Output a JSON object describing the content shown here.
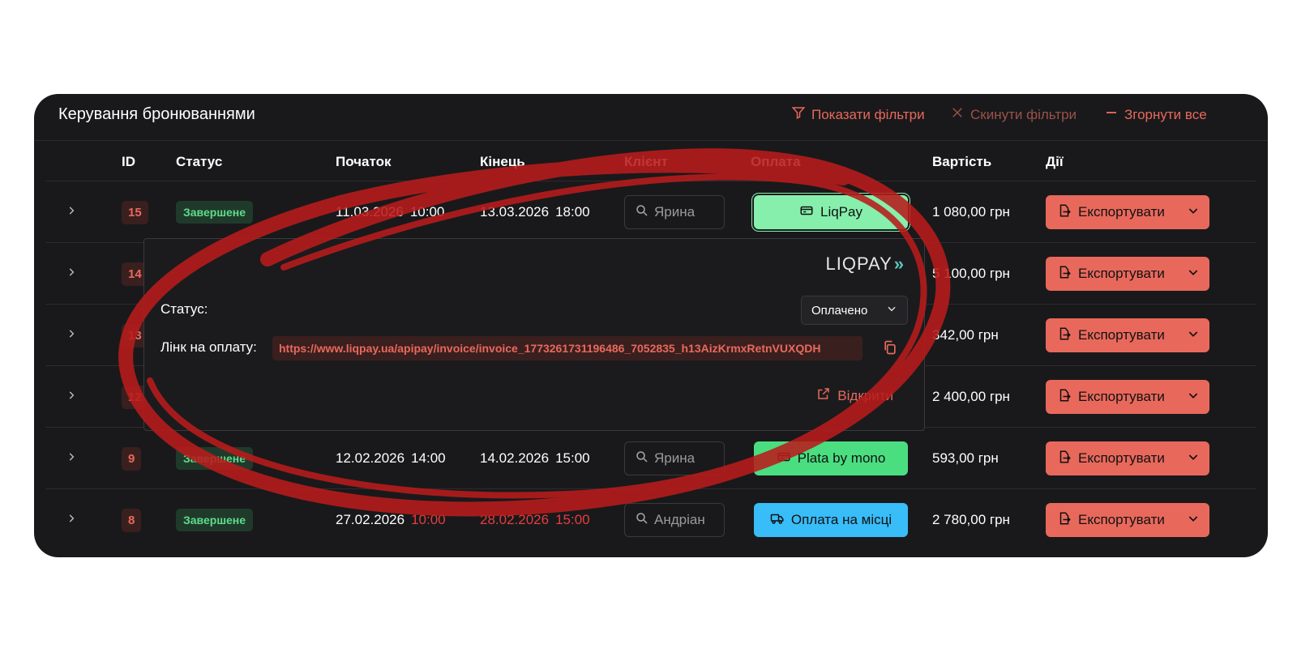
{
  "header": {
    "title": "Керування бронюваннями",
    "show_filters": "Показати фільтри",
    "reset_filters": "Скинути фільтри",
    "collapse_all": "Згорнути все"
  },
  "columns": {
    "id": "ID",
    "status": "Статус",
    "start": "Початок",
    "end": "Кінець",
    "client": "Клієнт",
    "payment": "Оплата",
    "cost": "Вартість",
    "actions": "Дії"
  },
  "rows": [
    {
      "id": "15",
      "status": "Завершене",
      "start_date": "11.03.2026",
      "start_time": "10:00",
      "end_date": "13.03.2026",
      "end_time": "18:00",
      "client": "Ярина",
      "payment": "LiqPay",
      "cost": "1 080,00 грн",
      "export": "Експортувати"
    },
    {
      "id": "14",
      "cost": "5 100,00 грн",
      "export": "Експортувати"
    },
    {
      "id": "13",
      "cost": "342,00 грн",
      "export": "Експортувати"
    },
    {
      "id": "12",
      "cost": "2 400,00 грн",
      "export": "Експортувати"
    },
    {
      "id": "9",
      "status": "Завершене",
      "start_date": "12.02.2026",
      "start_time": "14:00",
      "end_date": "14.02.2026",
      "end_time": "15:00",
      "client": "Ярина",
      "payment": "Plata by mono",
      "cost": "593,00 грн",
      "export": "Експортувати"
    },
    {
      "id": "8",
      "status": "Завершене",
      "start_date": "27.02.2026",
      "start_time": "10:00",
      "end_date": "28.02.2026",
      "end_time": "15:00",
      "client": "Андріан",
      "payment": "Оплата на місці",
      "cost": "2 780,00 грн",
      "export": "Експортувати"
    }
  ],
  "popover": {
    "logo": "LIQPAY",
    "status_label": "Статус:",
    "status_value": "Оплачено",
    "link_label": "Лінк на оплату:",
    "link_value": "https://www.liqpay.ua/apipay/invoice/invoice_1773261731196486_7052835_h13AizKrmxRetnVUXQDH",
    "open_label": "Відкрити"
  },
  "colors": {
    "accent": "#e8695c",
    "panel": "#19191b",
    "liqpay": "#86efac",
    "mono": "#4ade80",
    "onsite": "#38bdf8",
    "annotation": "#b91c1c"
  }
}
